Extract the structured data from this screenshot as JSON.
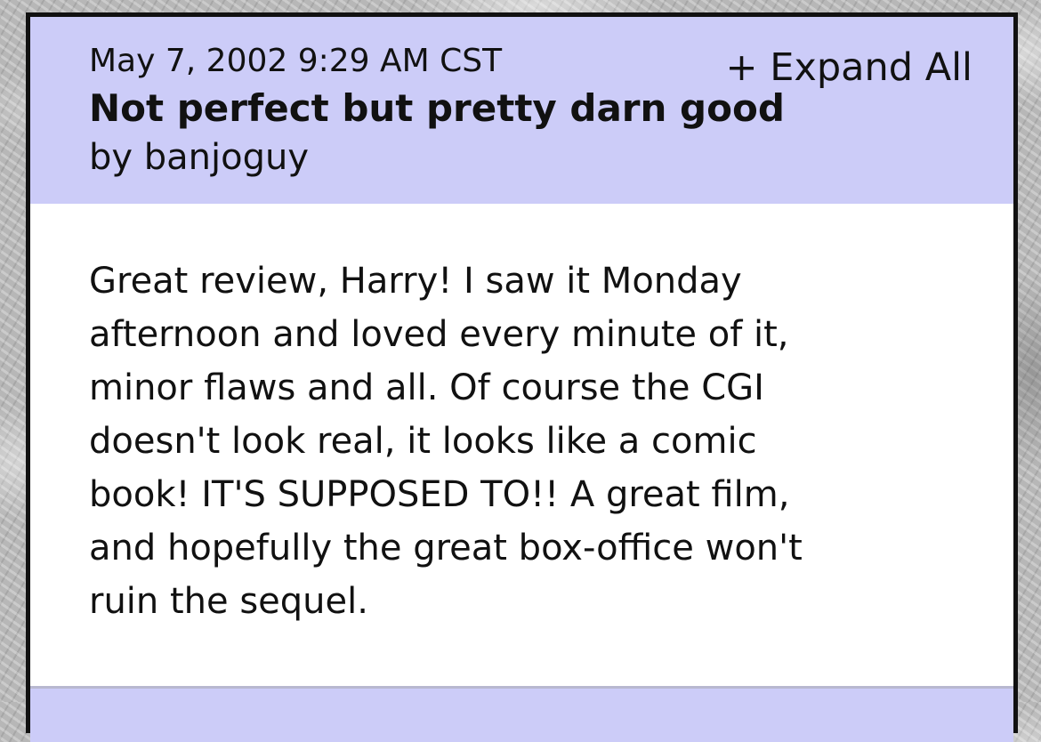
{
  "comment": {
    "timestamp": "May 7, 2002 9:29 AM CST",
    "expand_all_label": "+ Expand All",
    "title": "Not perfect but pretty darn good",
    "author": "by banjoguy",
    "body_lines": [
      "Great review, Harry! I saw it Monday",
      "afternoon and loved every minute of it,",
      "minor flaws and all. Of course the CGI",
      "doesn't look real, it looks like a comic",
      "book! IT'S SUPPOSED TO!! A great film,",
      "and hopefully the great box-office won't",
      "ruin the sequel."
    ]
  },
  "colors": {
    "header_background": "#ccccf8",
    "card_border": "#111111",
    "body_background": "#ffffff"
  }
}
